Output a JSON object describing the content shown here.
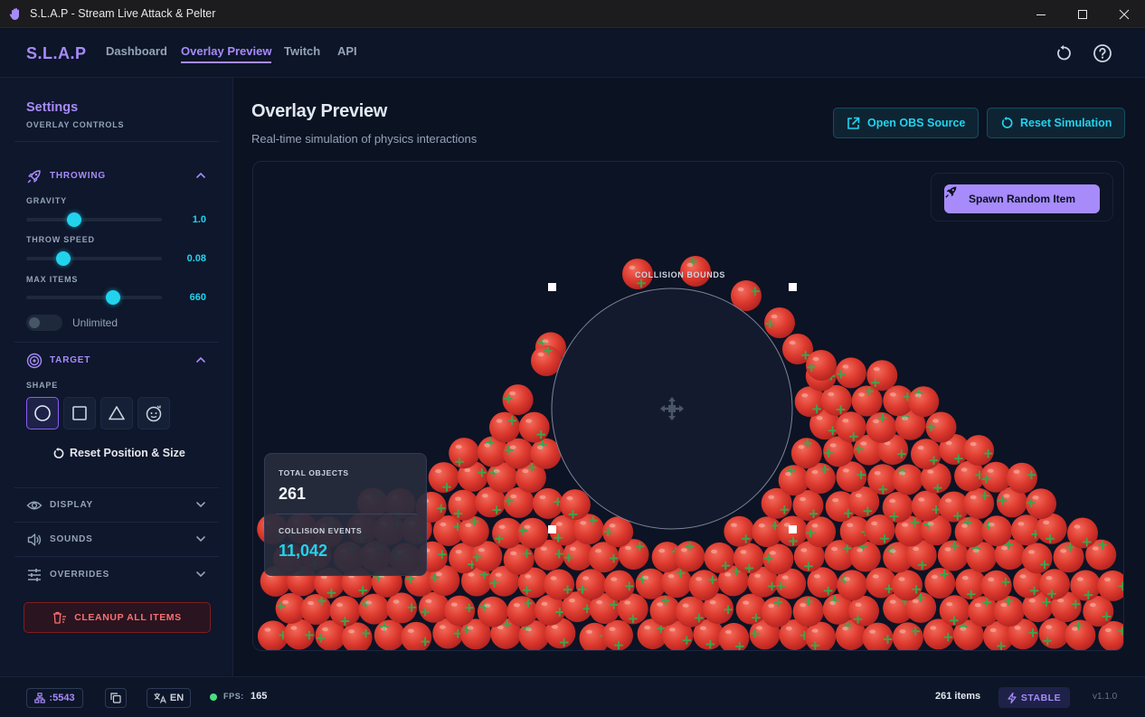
{
  "window": {
    "title": "S.L.A.P - Stream Live Attack & Pelter",
    "app_icon": "hand-icon",
    "controls": [
      "minimize-icon",
      "maximize-icon",
      "close-icon"
    ]
  },
  "nav": {
    "brand": "S.L.A.P",
    "links": [
      {
        "label": "Dashboard",
        "active": false
      },
      {
        "label": "Overlay Preview",
        "active": true
      },
      {
        "label": "Twitch",
        "active": false
      },
      {
        "label": "API",
        "active": false
      }
    ],
    "icons": [
      "refresh-icon",
      "help-icon"
    ]
  },
  "sidebar": {
    "title": "Settings",
    "subtitle": "OVERLAY CONTROLS",
    "throwing": {
      "label": "THROWING",
      "icon": "rocket-icon",
      "expanded": true,
      "gravity": {
        "label": "GRAVITY",
        "value": "1.0",
        "fraction": 0.35
      },
      "throw_speed": {
        "label": "THROW SPEED",
        "value": "0.08",
        "fraction": 0.27
      },
      "max_items": {
        "label": "MAX ITEMS",
        "value": "660",
        "fraction": 0.64
      },
      "unlimited": {
        "label": "Unlimited",
        "on": false
      }
    },
    "target": {
      "label": "TARGET",
      "icon": "target-icon",
      "expanded": true,
      "shape_label": "SHAPE",
      "shapes": [
        "circle-icon",
        "square-icon",
        "triangle-icon",
        "face-icon"
      ],
      "active_shape": "circle",
      "reset_label": "Reset Position & Size"
    },
    "display": {
      "label": "DISPLAY",
      "icon": "eye-icon"
    },
    "sounds": {
      "label": "SOUNDS",
      "icon": "speaker-icon"
    },
    "overrides": {
      "label": "OVERRIDES",
      "icon": "sliders-icon"
    },
    "cleanup_label": "CLEANUP ALL ITEMS"
  },
  "main": {
    "title": "Overlay Preview",
    "subtitle": "Real-time simulation of physics interactions",
    "open_obs_label": "Open OBS Source",
    "reset_sim_label": "Reset Simulation",
    "spawn_label": "Spawn Random Item",
    "collision_label": "COLLISION BOUNDS",
    "stats": {
      "total_label": "TOTAL OBJECTS",
      "total_value": "261",
      "collision_label": "COLLISION EVENTS",
      "collision_value": "11,042"
    },
    "item_type": "tomato"
  },
  "status": {
    "port": ":5543",
    "language": "EN",
    "fps_label": "FPS:",
    "fps_value": "165",
    "items": "261 items",
    "stability": "STABLE",
    "version": "v1.1.0"
  },
  "colors": {
    "accent_purple": "#a78bfa",
    "accent_cyan": "#22d3ee",
    "danger": "#f87171",
    "tomato": "#e53935",
    "background": "#0b1222"
  }
}
